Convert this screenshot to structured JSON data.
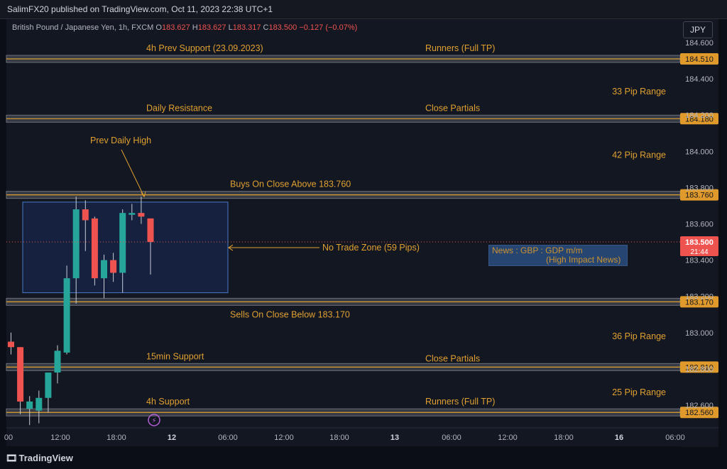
{
  "header": {
    "published": "SalimFX20 published on TradingView.com, Oct 11, 2023 22:38 UTC+1"
  },
  "symbol": {
    "name": "British Pound / Japanese Yen, 1h, FXCM",
    "o_label": "O",
    "o": "183.627",
    "h_label": "H",
    "h": "183.627",
    "l_label": "L",
    "l": "183.317",
    "c_label": "C",
    "c": "183.500",
    "change": "−0.127 (−0.07%)"
  },
  "currency": "JPY",
  "footer": {
    "brand": "TradingView"
  },
  "news": {
    "line1": "News : GBP : GDP m/m",
    "line2": "(High Impact News)"
  },
  "chart_data": {
    "type": "candlestick",
    "y_axis": {
      "range": [
        182.48,
        184.71
      ],
      "ticks": [
        "184.600",
        "184.400",
        "184.200",
        "184.000",
        "183.800",
        "183.600",
        "183.400",
        "183.200",
        "183.000",
        "182.800",
        "182.600"
      ]
    },
    "x_axis": {
      "ticks": [
        "00",
        "12:00",
        "18:00",
        "12",
        "06:00",
        "12:00",
        "18:00",
        "13",
        "06:00",
        "12:00",
        "18:00",
        "16",
        "06:00"
      ]
    },
    "levels": [
      {
        "price": 184.51,
        "label": "184.510",
        "left_text": "4h Prev Support (23.09.2023)",
        "right_text": "Runners (Full TP)"
      },
      {
        "price": 184.18,
        "label": "184.180",
        "left_text": "Daily Resistance",
        "right_text": "Close Partials"
      },
      {
        "price": 183.76,
        "label": "183.760",
        "left_text": "Buys On Close Above 183.760",
        "right_text": ""
      },
      {
        "price": 183.17,
        "label": "183.170",
        "left_text": "Sells On Close Below 183.170",
        "right_text": ""
      },
      {
        "price": 182.81,
        "label": "182.810",
        "left_text": "15min Support",
        "right_text": "Close Partials"
      },
      {
        "price": 182.56,
        "label": "182.560",
        "left_text": "4h Support",
        "right_text": "Runners (Full TP)"
      }
    ],
    "ranges": [
      {
        "price": 184.33,
        "label": "33 Pip Range"
      },
      {
        "price": 183.98,
        "label": "42 Pip Range"
      },
      {
        "price": 182.98,
        "label": "36 Pip Range"
      },
      {
        "price": 182.67,
        "label": "25 Pip Range"
      }
    ],
    "annotations": {
      "prev_daily_high": "Prev Daily High",
      "no_trade_zone": "No Trade Zone (59 Pips)"
    },
    "zone": {
      "top": 183.72,
      "bottom": 183.22
    },
    "current_price": {
      "price": 183.5,
      "label": "183.500",
      "countdown": "21:44"
    },
    "candles": [
      {
        "o": 182.95,
        "h": 183.0,
        "l": 182.88,
        "c": 182.92
      },
      {
        "o": 182.92,
        "h": 182.92,
        "l": 182.55,
        "c": 182.62
      },
      {
        "o": 182.58,
        "h": 182.65,
        "l": 182.49,
        "c": 182.62
      },
      {
        "o": 182.57,
        "h": 182.68,
        "l": 182.5,
        "c": 182.64
      },
      {
        "o": 182.64,
        "h": 182.77,
        "l": 182.56,
        "c": 182.78
      },
      {
        "o": 182.78,
        "h": 182.93,
        "l": 182.72,
        "c": 182.9
      },
      {
        "o": 182.89,
        "h": 183.37,
        "l": 182.88,
        "c": 183.3
      },
      {
        "o": 183.3,
        "h": 183.75,
        "l": 183.16,
        "c": 183.68
      },
      {
        "o": 183.68,
        "h": 183.73,
        "l": 183.45,
        "c": 183.62
      },
      {
        "o": 183.63,
        "h": 183.64,
        "l": 183.26,
        "c": 183.3
      },
      {
        "o": 183.3,
        "h": 183.43,
        "l": 183.19,
        "c": 183.4
      },
      {
        "o": 183.4,
        "h": 183.44,
        "l": 183.28,
        "c": 183.33
      },
      {
        "o": 183.33,
        "h": 183.68,
        "l": 183.22,
        "c": 183.66
      },
      {
        "o": 183.65,
        "h": 183.71,
        "l": 183.62,
        "c": 183.66
      },
      {
        "o": 183.66,
        "h": 183.75,
        "l": 183.6,
        "c": 183.64
      },
      {
        "o": 183.63,
        "h": 183.63,
        "l": 183.32,
        "c": 183.5
      }
    ]
  }
}
